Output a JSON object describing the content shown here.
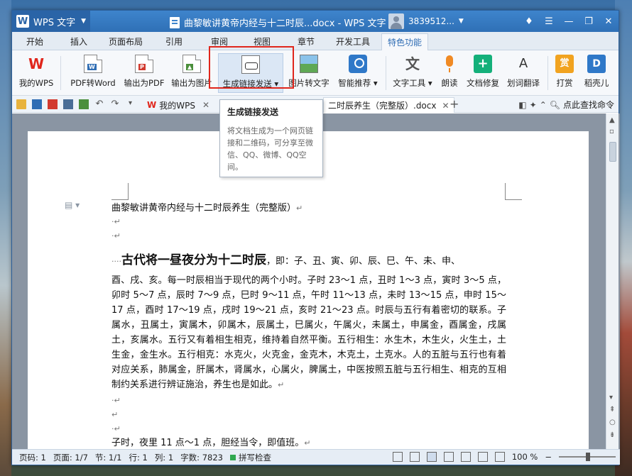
{
  "window": {
    "app_name": "WPS 文字",
    "doc_title": "曲黎敏讲黄帝内经与十二时辰...docx - WPS 文字",
    "user_id": "3839512..."
  },
  "tabs": [
    "开始",
    "插入",
    "页面布局",
    "引用",
    "审阅",
    "视图",
    "章节",
    "开发工具",
    "特色功能"
  ],
  "active_tab": "特色功能",
  "ribbon": {
    "my_wps": "我的WPS",
    "pdf_to_word": "PDF转Word",
    "export_pdf": "输出为PDF",
    "export_image": "输出为图片",
    "gen_link": "生成链接发送",
    "image_to_text": "图片转文字",
    "smart_recommend": "智能推荐",
    "text_tools": "文字工具",
    "read_aloud": "朗读",
    "doc_repair": "文档修复",
    "word_translate": "划词翻译",
    "reward": "打赏",
    "shell": "稻壳儿"
  },
  "doc_tabs": {
    "my_wps": "我的WPS",
    "current": "二时辰养生（完整版）.docx"
  },
  "search_command": "点此查找命令",
  "tooltip": {
    "title": "生成链接发送",
    "body": "将文档生成为一个网页链接和二维码，可分享至微信、QQ、微博、QQ空间。"
  },
  "document": {
    "title_line": "曲黎敏讲黄帝内经与十二时辰养生（完整版）",
    "heading_bold": "古代将一昼夜分为十二时辰",
    "heading_rest": "，即：子、丑、寅、卯、辰、巳、午、未、申、",
    "body": "酉、戌、亥。每一时辰相当于现代的两个小时。子时 23～1 点，丑时 1～3 点，寅时 3～5 点，卯时 5～7 点，辰时 7～9 点，巳时 9～11 点，午时 11～13 点，未时 13～15 点，申时 15～17 点，酉时 17～19 点，戌时 19～21 点，亥时 21～23 点。时辰与五行有着密切的联系。子属水，丑属土，寅属木，卯属木，辰属土，巳属火，午属火，未属土，申属金，酉属金，戌属土，亥属水。五行又有着相生相克，维持着自然平衡。五行相生：水生木，木生火，火生土，土生金，金生水。五行相克：水克火，火克金，金克木，木克土，土克水。人的五脏与五行也有着对应关系，肺属金，肝属木，肾属水，心属火，脾属土，中医按照五脏与五行相生、相克的互相制约关系进行辨证施治，养生也是如此。",
    "last_line": "子时，夜里 11 点～1 点，胆经当令，即值班。"
  },
  "status": {
    "page_no": "页码: 1",
    "pages": "页面: 1/7",
    "section": "节: 1/1",
    "row": "行: 1",
    "col": "列: 1",
    "word_count": "字数: 7823",
    "spell_check": "拼写检查",
    "zoom": "100 %"
  }
}
